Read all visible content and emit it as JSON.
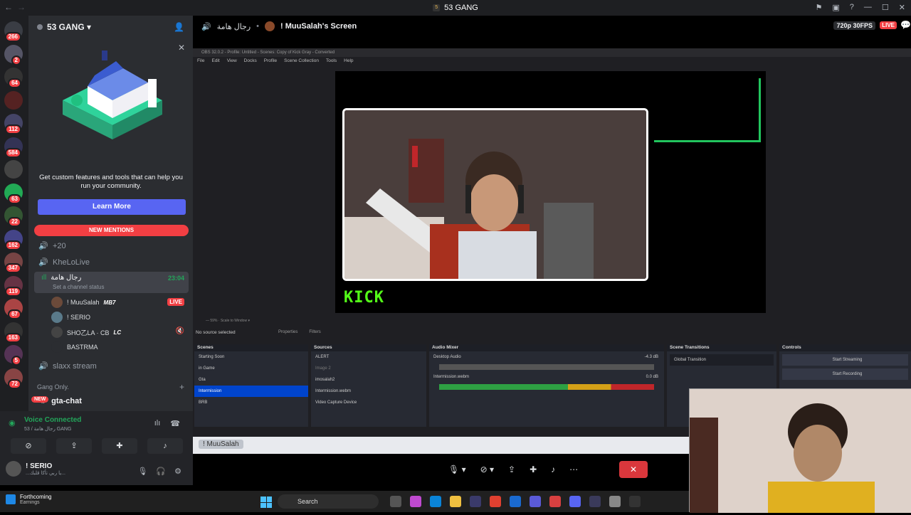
{
  "titlebar": {
    "server_name": "53 GANG",
    "server_abbrev": "5"
  },
  "rail": [
    {
      "badge": "266"
    },
    {
      "badge": "2"
    },
    {
      "badge": "64"
    },
    {
      "badge": ""
    },
    {
      "badge": "112"
    },
    {
      "badge": "584"
    },
    {
      "badge": ""
    },
    {
      "badge": "63"
    },
    {
      "badge": "22"
    },
    {
      "badge": "162"
    },
    {
      "badge": "347"
    },
    {
      "badge": "119"
    },
    {
      "badge": "67"
    },
    {
      "badge": "163"
    },
    {
      "badge": "5"
    },
    {
      "badge": "72"
    }
  ],
  "channels": {
    "server_name": "53 GANG",
    "promo_text": "Get custom features and tools that can help you run your community.",
    "learn_more": "Learn More",
    "new_mentions": "NEW MENTIONS",
    "items": [
      {
        "label": "+20"
      },
      {
        "label": "KheLoLive"
      }
    ],
    "active_channel": {
      "name": "رجال هامة",
      "timer": "23:04",
      "status": "Set a channel status"
    },
    "voice_users": [
      {
        "name": "! MuuSalah",
        "tag": "MB7",
        "live": "LIVE"
      },
      {
        "name": "! SERIO",
        "tag": "",
        "live": ""
      },
      {
        "name": "SHO乙LA · CB",
        "tag": "LC",
        "live": ""
      },
      {
        "name": "BASTRMA",
        "tag": "",
        "live": ""
      }
    ],
    "slaxx": "slaxx stream",
    "gang_only": "Gang Only.",
    "gta_chat": "gta-chat",
    "new_pill": "NEW"
  },
  "voice": {
    "connected": "Voice Connected",
    "sub": "53 / رجال هامة GANG",
    "me_name": "! SERIO",
    "me_status": "...يا ربي تأكا قلبك..."
  },
  "stream": {
    "channel": "رجال هامة",
    "who": "! MuuSalah's Screen",
    "resolution": "720p 30FPS",
    "live": "LIVE"
  },
  "obs": {
    "title": "OBS 32.0.2 - Profile: Untitled - Scenes: Copy of Kick Gray - Converted",
    "menu": [
      "File",
      "Edit",
      "View",
      "Docks",
      "Profile",
      "Scene Collection",
      "Tools",
      "Help"
    ],
    "kick_logo": "KICK",
    "no_source": "No source selected",
    "properties": "Properties",
    "filters": "Filters",
    "scenes_title": "Scenes",
    "scenes": [
      "Starting Soon",
      "in Game",
      "Gta",
      "Intermission",
      "BRB"
    ],
    "selected_scene": "Intermission",
    "sources_title": "Sources",
    "sources": [
      "ALERT",
      "Image 2",
      "imosalah2",
      "Intermission.webm",
      "Video Capture Device"
    ],
    "audio_title": "Audio Mixer",
    "audio_tracks": [
      "Desktop Audio",
      "Intermission.webm"
    ],
    "audio_levels": [
      "-4.3 dB",
      "0.0 dB"
    ],
    "transitions_title": "Scene Transitions",
    "transition_value": "Global Transition",
    "controls_title": "Controls",
    "controls": [
      "Start Streaming",
      "Start Recording"
    ],
    "footer_user": "! MuuSalah"
  },
  "taskbar": {
    "forthcoming": "Forthcoming",
    "earnings": "Earnings",
    "search": "Search"
  }
}
